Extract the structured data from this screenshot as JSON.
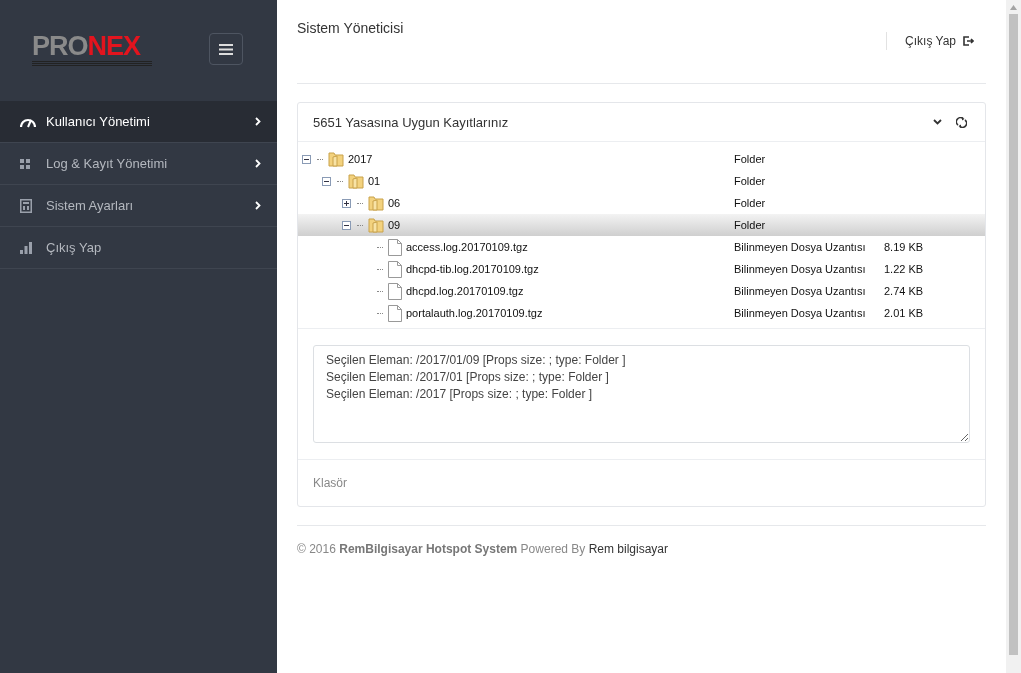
{
  "logo": {
    "parts": [
      {
        "text": "PRO",
        "color": "#8a8a8a"
      },
      {
        "text": "NEX",
        "color": "#e3141e"
      }
    ]
  },
  "sidebar": {
    "items": [
      {
        "label": "Kullanıcı Yönetimi",
        "selected": true,
        "has_submenu": true
      },
      {
        "label": "Log & Kayıt Yönetimi",
        "selected": false,
        "has_submenu": true
      },
      {
        "label": "Sistem Ayarları",
        "selected": false,
        "has_submenu": true
      },
      {
        "label": "Çıkış Yap",
        "selected": false,
        "has_submenu": false
      }
    ]
  },
  "header": {
    "title": "Sistem Yöneticisi",
    "logout": "Çıkış Yap"
  },
  "panel": {
    "title": "5651 Yasasına Uygun Kayıtlarınız",
    "tree": [
      {
        "kind": "folder",
        "name": "2017",
        "type": "Folder",
        "expanded": true,
        "selected": false,
        "children": [
          {
            "kind": "folder",
            "name": "01",
            "type": "Folder",
            "expanded": true,
            "selected": false,
            "children": [
              {
                "kind": "folder",
                "name": "06",
                "type": "Folder",
                "expanded": false,
                "selected": false
              },
              {
                "kind": "folder",
                "name": "09",
                "type": "Folder",
                "expanded": true,
                "selected": true,
                "children": [
                  {
                    "kind": "file",
                    "name": "access.log.20170109.tgz",
                    "type": "Bilinmeyen Dosya Uzantısı",
                    "size": "8.19 KB",
                    "selected": false
                  },
                  {
                    "kind": "file",
                    "name": "dhcpd-tib.log.20170109.tgz",
                    "type": "Bilinmeyen Dosya Uzantısı",
                    "size": "1.22 KB",
                    "selected": false
                  },
                  {
                    "kind": "file",
                    "name": "dhcpd.log.20170109.tgz",
                    "type": "Bilinmeyen Dosya Uzantısı",
                    "size": "2.74 KB",
                    "selected": false
                  },
                  {
                    "kind": "file",
                    "name": "portalauth.log.20170109.tgz",
                    "type": "Bilinmeyen Dosya Uzantısı",
                    "size": "2.01 KB",
                    "selected": false
                  }
                ]
              }
            ]
          }
        ]
      }
    ],
    "log_lines": [
      "Seçilen Eleman: /2017/01/09 [Props size: ; type: Folder ]",
      "Seçilen Eleman: /2017/01 [Props size: ; type: Folder ]",
      "Seçilen Eleman: /2017 [Props size: ; type: Folder ]"
    ],
    "footer_note": "Klasör"
  },
  "footer": {
    "text": "© 2016 **RemBilgisayar Hotspot System** Powered By",
    "link": "Rem bilgisayar"
  }
}
